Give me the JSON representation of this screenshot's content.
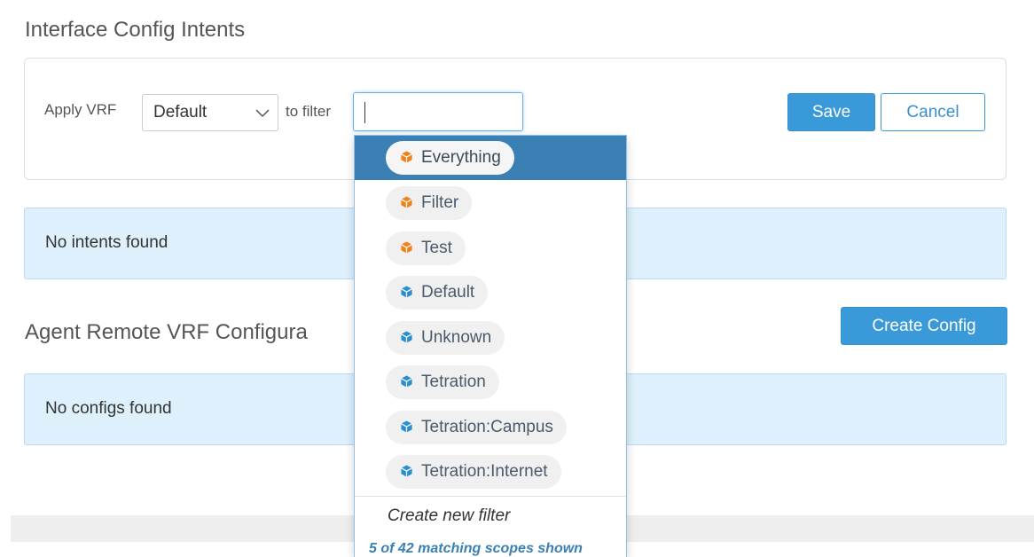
{
  "interface_section": {
    "title": "Interface Config Intents",
    "apply_vrf_label": "Apply VRF",
    "vrf_select_value": "Default",
    "to_filter_label": "to filter",
    "filter_input_value": "",
    "save_label": "Save",
    "cancel_label": "Cancel",
    "empty_message": "No intents found"
  },
  "agent_section": {
    "title": "Agent Remote VRF Configura",
    "create_config_label": "Create Config",
    "empty_message": "No configs found"
  },
  "dropdown": {
    "items": [
      {
        "label": "Everything",
        "icon": "cube-icon",
        "color": "#f0821e",
        "selected": true
      },
      {
        "label": "Filter",
        "icon": "cube-icon",
        "color": "#f0821e"
      },
      {
        "label": "Test",
        "icon": "cube-icon",
        "color": "#f0821e"
      },
      {
        "label": "Default",
        "icon": "cube-icon",
        "color": "#2b8fcf"
      },
      {
        "label": "Unknown",
        "icon": "cube-icon",
        "color": "#2b8fcf"
      },
      {
        "label": "Tetration",
        "icon": "cube-icon",
        "color": "#2b8fcf"
      },
      {
        "label": "Tetration:Campus",
        "icon": "cube-icon",
        "color": "#2b8fcf"
      },
      {
        "label": "Tetration:Internet",
        "icon": "cube-icon",
        "color": "#2b8fcf"
      }
    ],
    "create_new_label": "Create new filter",
    "matching_text": "5 of 42 matching scopes shown"
  },
  "colors": {
    "primary": "#3a9ad9",
    "highlight": "#3a80b4",
    "alert_bg": "#def0fb",
    "filter_icon": "#f0821e",
    "scope_icon": "#2b8fcf"
  }
}
